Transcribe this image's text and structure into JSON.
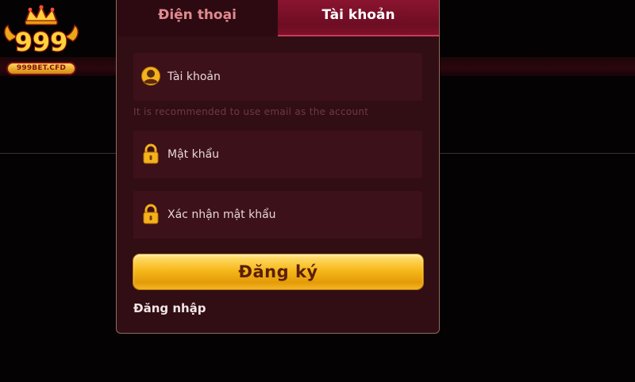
{
  "logo": {
    "number": "999",
    "wordmark": "999BET.CFD",
    "icon": "crown-icon"
  },
  "tabs": [
    {
      "label": "Điện thoại",
      "active": false
    },
    {
      "label": "Tài khoản",
      "active": true
    }
  ],
  "form": {
    "account_label": "Tài khoản",
    "account_icon": "user-avatar-icon",
    "hint": "It is recommended to use email as the account",
    "password_label": "Mật khẩu",
    "password_icon": "lock-icon",
    "confirm_label": "Xác nhận mật khẩu",
    "confirm_icon": "lock-icon",
    "register_button": "Đăng ký",
    "login_link": "Đăng nhập"
  },
  "colors": {
    "panel_bg": "#310d14",
    "field_bg": "#3d1119",
    "active_tab": "#7c1128",
    "inactive_tab_text": "#e08a8f",
    "button_gold": "#f7b91c"
  }
}
